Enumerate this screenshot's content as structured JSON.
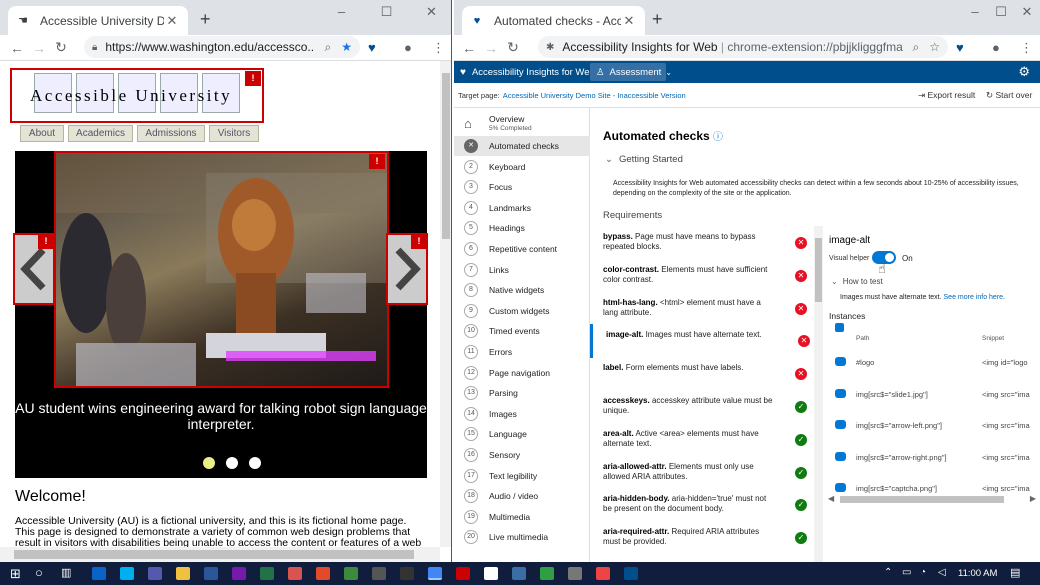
{
  "left_window": {
    "tab_title": "Accessible University Demo Site",
    "url": "https://www.washington.edu/accessco...",
    "page": {
      "logo_text": "Accessible University",
      "nav_tabs": [
        "About",
        "Academics",
        "Admissions",
        "Visitors"
      ],
      "error_marker": "!",
      "caption": "AU student wins engineering award for talking robot sign language interpreter.",
      "welcome": "Welcome!",
      "intro": "Accessible University (AU) is a fictional university, and this is its fictional home page. This page is designed to demonstrate a variety of common web design problems that result in visitors with disabilities being unable to access the content or features of a web page. Although the heading at the"
    }
  },
  "right_window": {
    "tab_title": "Automated checks - Accessibility",
    "omnibox": {
      "site_name": "Accessibility Insights for Web",
      "url": "chrome-extension://pbjjkligggfmak..."
    },
    "app": {
      "brand": "Accessibility Insights for Web",
      "mode": "Assessment",
      "target_label": "Target page:",
      "target_link": "Accessible University Demo Site - Inaccessible Version",
      "export": "Export result",
      "start_over": "Start over",
      "overview": {
        "label": "Overview",
        "progress": "5% Completed"
      },
      "nav": [
        {
          "num": "",
          "label": "Automated checks"
        },
        {
          "num": "2",
          "label": "Keyboard"
        },
        {
          "num": "3",
          "label": "Focus"
        },
        {
          "num": "4",
          "label": "Landmarks"
        },
        {
          "num": "5",
          "label": "Headings"
        },
        {
          "num": "6",
          "label": "Repetitive content"
        },
        {
          "num": "7",
          "label": "Links"
        },
        {
          "num": "8",
          "label": "Native widgets"
        },
        {
          "num": "9",
          "label": "Custom widgets"
        },
        {
          "num": "10",
          "label": "Timed events"
        },
        {
          "num": "11",
          "label": "Errors"
        },
        {
          "num": "12",
          "label": "Page navigation"
        },
        {
          "num": "13",
          "label": "Parsing"
        },
        {
          "num": "14",
          "label": "Images"
        },
        {
          "num": "15",
          "label": "Language"
        },
        {
          "num": "16",
          "label": "Sensory"
        },
        {
          "num": "17",
          "label": "Text legibility"
        },
        {
          "num": "18",
          "label": "Audio / video"
        },
        {
          "num": "19",
          "label": "Multimedia"
        },
        {
          "num": "20",
          "label": "Live multimedia"
        }
      ],
      "heading": "Automated checks",
      "getting_started": "Getting Started",
      "getting_started_text": "Accessibility Insights for Web automated accessibility checks can detect within a few seconds about 10-25% of accessibility issues, depending on the complexity of the site or the application.",
      "requirements_label": "Requirements",
      "requirements": [
        {
          "name": "bypass.",
          "desc": "Page must have means to bypass repeated blocks.",
          "status": "fail",
          "icon": "✕"
        },
        {
          "name": "color-contrast.",
          "desc": "Elements must have sufficient color contrast.",
          "status": "fail",
          "icon": "✕"
        },
        {
          "name": "html-has-lang.",
          "desc": "<html> element must have a lang attribute.",
          "status": "fail",
          "icon": "✕"
        },
        {
          "name": "image-alt.",
          "desc": "Images must have alternate text.",
          "status": "fail",
          "icon": "✕"
        },
        {
          "name": "label.",
          "desc": "Form elements must have labels.",
          "status": "fail",
          "icon": "✕"
        },
        {
          "name": "accesskeys.",
          "desc": "accesskey attribute value must be unique.",
          "status": "pass",
          "icon": "✓"
        },
        {
          "name": "area-alt.",
          "desc": "Active <area> elements must have alternate text.",
          "status": "pass",
          "icon": "✓"
        },
        {
          "name": "aria-allowed-attr.",
          "desc": "Elements must only use allowed ARIA attributes.",
          "status": "pass",
          "icon": "✓"
        },
        {
          "name": "aria-hidden-body.",
          "desc": "aria-hidden='true' must not be present on the document body.",
          "status": "pass",
          "icon": "✓"
        },
        {
          "name": "aria-required-attr.",
          "desc": "Required ARIA attributes must be provided.",
          "status": "pass",
          "icon": "✓"
        }
      ],
      "details": {
        "title": "image-alt",
        "visual_helper": "Visual helper",
        "toggle_state": "On",
        "how_to_test": "How to test",
        "how_desc": "Images must have alternate text.",
        "see_more": "See more info here.",
        "instances_label": "Instances",
        "col_path": "Path",
        "col_snippet": "Snippet",
        "instances": [
          {
            "path": "#logo",
            "snippet": "<img id=\"logo"
          },
          {
            "path": "img[src$=\"slide1.jpg\"]",
            "snippet": "<img src=\"ima"
          },
          {
            "path": "img[src$=\"arrow-left.png\"]",
            "snippet": "<img src=\"ima"
          },
          {
            "path": "img[src$=\"arrow-right.png\"]",
            "snippet": "<img src=\"ima"
          },
          {
            "path": "img[src$=\"captcha.png\"]",
            "snippet": "<img src=\"ima"
          }
        ]
      }
    }
  },
  "taskbar": {
    "time": "11:00 AM"
  },
  "colors": {
    "brand": "#004e8c",
    "fail": "#e81123",
    "pass": "#107c10",
    "error_flag": "#cc0000"
  }
}
